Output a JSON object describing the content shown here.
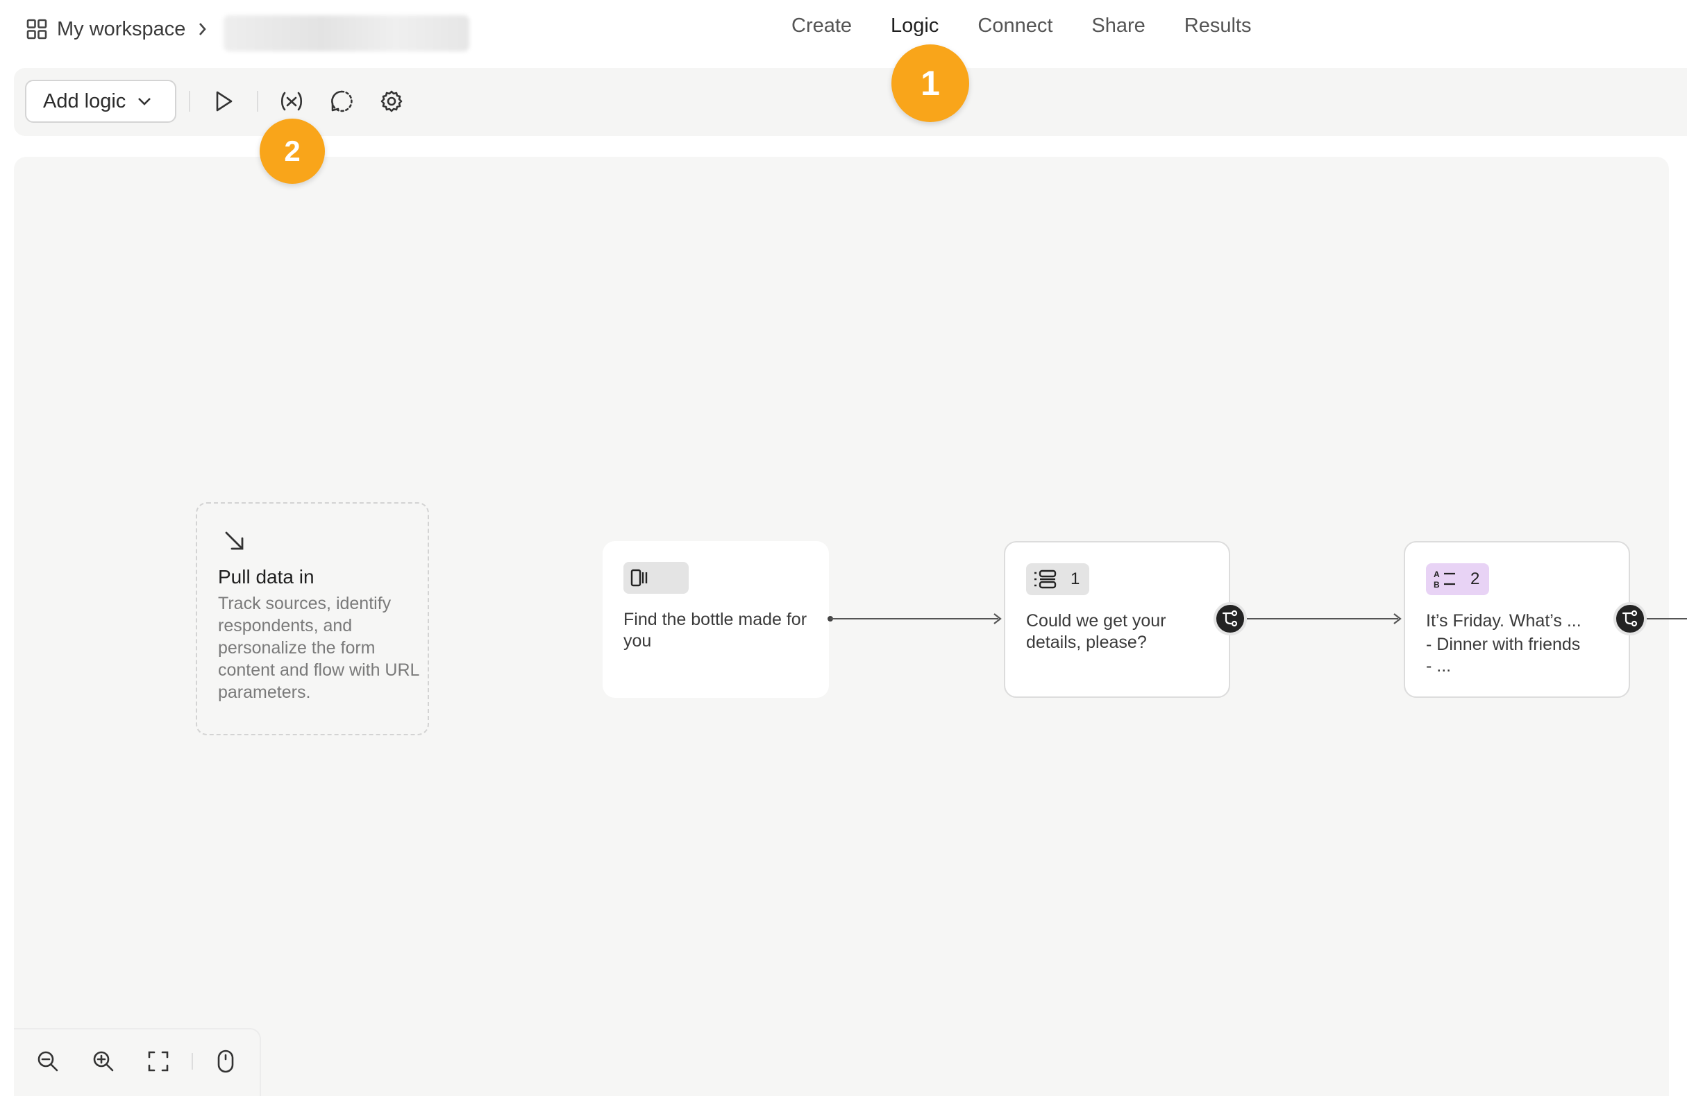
{
  "breadcrumb": {
    "workspace": "My workspace",
    "icon": "grid-icon"
  },
  "nav": {
    "tabs": [
      {
        "label": "Create"
      },
      {
        "label": "Logic",
        "active": true
      },
      {
        "label": "Connect"
      },
      {
        "label": "Share"
      },
      {
        "label": "Results"
      }
    ]
  },
  "toolbar": {
    "add_logic_label": "Add logic",
    "icons": [
      "play-icon",
      "variable-icon",
      "history-icon",
      "settings-icon"
    ]
  },
  "callouts": {
    "one": "1",
    "two": "2"
  },
  "canvas": {
    "pull_data": {
      "title": "Pull data in",
      "description": "Track sources, identify respondents, and personalize the form content and flow with URL parameters."
    },
    "nodes": [
      {
        "badge_icon": "welcome-screen-icon",
        "badge_number": "",
        "text": "Find the bottle made for you"
      },
      {
        "badge_icon": "contact-info-icon",
        "badge_number": "1",
        "text": "Could we get your details, please?"
      },
      {
        "badge_icon": "multiple-choice-icon",
        "badge_number": "2",
        "text": "It’s Friday. What’s ...",
        "text_extra": "- Dinner with friends\n- ..."
      }
    ]
  },
  "colors": {
    "accent": "#f9a51a",
    "badge_gray": "#e4e4e4",
    "badge_purple": "#e8d3f5",
    "canvas": "#f6f6f5"
  },
  "zoom_controls": [
    "zoom-out-icon",
    "zoom-in-icon",
    "fit-screen-icon",
    "mouse-icon"
  ]
}
